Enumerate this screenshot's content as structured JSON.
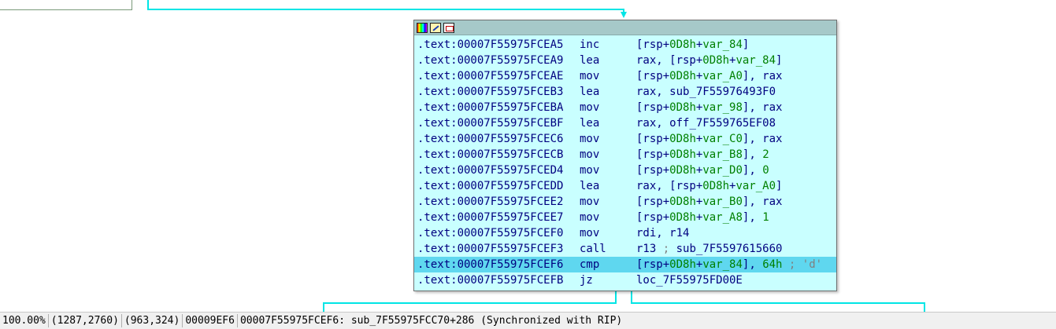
{
  "graph": {
    "node": {
      "toolbar": [
        "color-icon",
        "rename-icon",
        "graph-icon"
      ],
      "lines": [
        {
          "addr": ".text:00007F55975FCEA5",
          "mnem": "inc",
          "ops": [
            {
              "t": "[rsp+"
            },
            {
              "t": "0D8h",
              "c": "num"
            },
            {
              "t": "+"
            },
            {
              "t": "var_84",
              "c": "var"
            },
            {
              "t": "]"
            }
          ]
        },
        {
          "addr": ".text:00007F55975FCEA9",
          "mnem": "lea",
          "ops": [
            {
              "t": "rax, [rsp+"
            },
            {
              "t": "0D8h",
              "c": "num"
            },
            {
              "t": "+"
            },
            {
              "t": "var_84",
              "c": "var"
            },
            {
              "t": "]"
            }
          ]
        },
        {
          "addr": ".text:00007F55975FCEAE",
          "mnem": "mov",
          "ops": [
            {
              "t": "[rsp+"
            },
            {
              "t": "0D8h",
              "c": "num"
            },
            {
              "t": "+"
            },
            {
              "t": "var_A0",
              "c": "var"
            },
            {
              "t": "], rax"
            }
          ]
        },
        {
          "addr": ".text:00007F55975FCEB3",
          "mnem": "lea",
          "ops": [
            {
              "t": "rax, "
            },
            {
              "t": "sub_7F55976493F0",
              "c": "sub"
            }
          ]
        },
        {
          "addr": ".text:00007F55975FCEBA",
          "mnem": "mov",
          "ops": [
            {
              "t": "[rsp+"
            },
            {
              "t": "0D8h",
              "c": "num"
            },
            {
              "t": "+"
            },
            {
              "t": "var_98",
              "c": "var"
            },
            {
              "t": "], rax"
            }
          ]
        },
        {
          "addr": ".text:00007F55975FCEBF",
          "mnem": "lea",
          "ops": [
            {
              "t": "rax, "
            },
            {
              "t": "off_7F559765EF08",
              "c": "sub"
            }
          ]
        },
        {
          "addr": ".text:00007F55975FCEC6",
          "mnem": "mov",
          "ops": [
            {
              "t": "[rsp+"
            },
            {
              "t": "0D8h",
              "c": "num"
            },
            {
              "t": "+"
            },
            {
              "t": "var_C0",
              "c": "var"
            },
            {
              "t": "], rax"
            }
          ]
        },
        {
          "addr": ".text:00007F55975FCECB",
          "mnem": "mov",
          "ops": [
            {
              "t": "[rsp+"
            },
            {
              "t": "0D8h",
              "c": "num"
            },
            {
              "t": "+"
            },
            {
              "t": "var_B8",
              "c": "var"
            },
            {
              "t": "], "
            },
            {
              "t": "2",
              "c": "num"
            }
          ]
        },
        {
          "addr": ".text:00007F55975FCED4",
          "mnem": "mov",
          "ops": [
            {
              "t": "[rsp+"
            },
            {
              "t": "0D8h",
              "c": "num"
            },
            {
              "t": "+"
            },
            {
              "t": "var_D0",
              "c": "var"
            },
            {
              "t": "], "
            },
            {
              "t": "0",
              "c": "num"
            }
          ]
        },
        {
          "addr": ".text:00007F55975FCEDD",
          "mnem": "lea",
          "ops": [
            {
              "t": "rax, [rsp+"
            },
            {
              "t": "0D8h",
              "c": "num"
            },
            {
              "t": "+"
            },
            {
              "t": "var_A0",
              "c": "var"
            },
            {
              "t": "]"
            }
          ]
        },
        {
          "addr": ".text:00007F55975FCEE2",
          "mnem": "mov",
          "ops": [
            {
              "t": "[rsp+"
            },
            {
              "t": "0D8h",
              "c": "num"
            },
            {
              "t": "+"
            },
            {
              "t": "var_B0",
              "c": "var"
            },
            {
              "t": "], rax"
            }
          ]
        },
        {
          "addr": ".text:00007F55975FCEE7",
          "mnem": "mov",
          "ops": [
            {
              "t": "[rsp+"
            },
            {
              "t": "0D8h",
              "c": "num"
            },
            {
              "t": "+"
            },
            {
              "t": "var_A8",
              "c": "var"
            },
            {
              "t": "], "
            },
            {
              "t": "1",
              "c": "num"
            }
          ]
        },
        {
          "addr": ".text:00007F55975FCEF0",
          "mnem": "mov",
          "ops": [
            {
              "t": "rdi, r14"
            }
          ]
        },
        {
          "addr": ".text:00007F55975FCEF3",
          "mnem": "call",
          "ops": [
            {
              "t": "r13"
            },
            {
              "t": " ; ",
              "c": "cmt"
            },
            {
              "t": "sub_7F5597615660",
              "c": "sub"
            }
          ]
        },
        {
          "addr": ".text:00007F55975FCEF6",
          "mnem": "cmp",
          "selected": true,
          "ops": [
            {
              "t": "[rsp+"
            },
            {
              "t": "0D8h",
              "c": "num"
            },
            {
              "t": "+"
            },
            {
              "t": "var_84",
              "c": "var"
            },
            {
              "t": "], "
            },
            {
              "t": "64h",
              "c": "num"
            },
            {
              "t": " ; 'd'",
              "c": "cmt"
            }
          ]
        },
        {
          "addr": ".text:00007F55975FCEFB",
          "mnem": "jz",
          "ops": [
            {
              "t": "loc_7F55975FD00E",
              "c": "sub"
            }
          ]
        }
      ]
    }
  },
  "statusbar": {
    "zoom": "100.00%",
    "graph_pos": "(1287,2760)",
    "mouse_pos": "(963,324)",
    "file_offset": "00009EF6",
    "location": "00007F55975FCEF6: sub_7F55975FCC70+286",
    "sync": "(Synchronized with RIP)"
  },
  "colors": {
    "node_bg": "#c9ffff",
    "title_bg": "#a6c9c9",
    "selected_line": "#5fd7ef",
    "edge": "#00e5e5",
    "code_text": "#000080",
    "number": "#008000"
  }
}
